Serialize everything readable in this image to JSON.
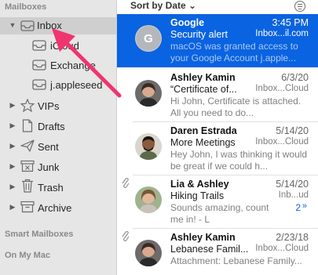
{
  "sidebar": {
    "header": "Mailboxes",
    "inbox": {
      "label": "Inbox"
    },
    "inbox_children": [
      {
        "label": "iCloud"
      },
      {
        "label": "Exchange"
      },
      {
        "label": "j.appleseed"
      }
    ],
    "folders": [
      {
        "label": "VIPs",
        "icon": "star-icon"
      },
      {
        "label": "Drafts",
        "icon": "document-icon"
      },
      {
        "label": "Sent",
        "icon": "paper-plane-icon"
      },
      {
        "label": "Junk",
        "icon": "junk-icon"
      },
      {
        "label": "Trash",
        "icon": "trash-icon"
      },
      {
        "label": "Archive",
        "icon": "archive-icon"
      }
    ],
    "smart_mailboxes": "Smart Mailboxes",
    "on_my_mac": "On My Mac"
  },
  "list": {
    "sort_label": "Sort by Date ⌄",
    "messages": [
      {
        "from": "Google",
        "date": "3:45 PM",
        "subject": "Security alert",
        "mailbox": "Inbox...il.com",
        "preview": "macOS was granted access to your Google Account j.apple...",
        "avatar_letter": "G",
        "selected": true
      },
      {
        "from": "Ashley Kamin",
        "date": "6/3/20",
        "subject": "“Certificate of...",
        "mailbox": "Inbox...Cloud",
        "preview": "Hi John, Certificate is attached. All you need to do..."
      },
      {
        "from": "Daren Estrada",
        "date": "5/14/20",
        "subject": "More Meetings",
        "mailbox": "Inbox...Cloud",
        "preview": "Hey John, I was thinking it would be great if we could h..."
      },
      {
        "from": "Lia & Ashley",
        "date": "5/14/20",
        "subject": "Hiking Trails",
        "mailbox": "Inb...ud",
        "preview": "Sounds amazing, count me in! - L",
        "thread_count": "2",
        "attachment": true
      },
      {
        "from": "Ashley Kamin",
        "date": "2/23/18",
        "subject": "Lebanese Famil...",
        "mailbox": "Inbox...Cloud",
        "preview": "Attachment: Lebanese Family...",
        "attachment": true
      }
    ]
  },
  "colors": {
    "selection_blue": "#0a63e0",
    "annotation_arrow": "#f0346f"
  }
}
